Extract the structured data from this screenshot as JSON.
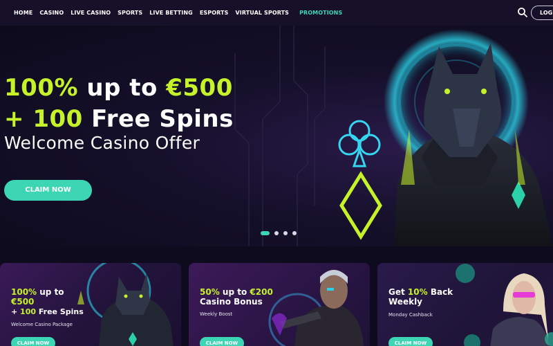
{
  "nav": {
    "links": [
      "HOME",
      "CASINO",
      "LIVE CASINO",
      "SPORTS",
      "LIVE BETTING",
      "ESPORTS",
      "VIRTUAL SPORTS"
    ],
    "promotions": "PROMOTIONS",
    "login": "LOG IN",
    "search_icon": "search-icon"
  },
  "hero": {
    "line1": {
      "a": "100%",
      "b": " up to ",
      "c": "€500"
    },
    "line2": {
      "a": "+ ",
      "b": "100",
      "c": " Free Spins"
    },
    "subtitle": "Welcome Casino Offer",
    "cta": "CLAIM NOW",
    "slides": 4,
    "active_slide": 1
  },
  "cards": [
    {
      "title_a": "100%",
      "title_b": " up to ",
      "title_c": "€500",
      "title_d": "+ ",
      "title_e": "100",
      "title_f": " Free Spins",
      "sub": "Welcome Casino Package",
      "cta": "CLAIM NOW"
    },
    {
      "title_a": "50%",
      "title_b": " up to ",
      "title_c": "€200",
      "title_d": "Casino Bonus",
      "sub": "Weekly Boost",
      "cta": "CLAIM NOW"
    },
    {
      "title_a": "Get ",
      "title_b": "10%",
      "title_c": " Back",
      "title_d": "Weekly",
      "sub": "Monday Cashback",
      "cta": "CLAIM NOW"
    }
  ],
  "colors": {
    "accent": "#3dd6b5",
    "highlight": "#c6f22a",
    "nav_bg": "#171029",
    "page_bg": "#0f0b1f"
  }
}
